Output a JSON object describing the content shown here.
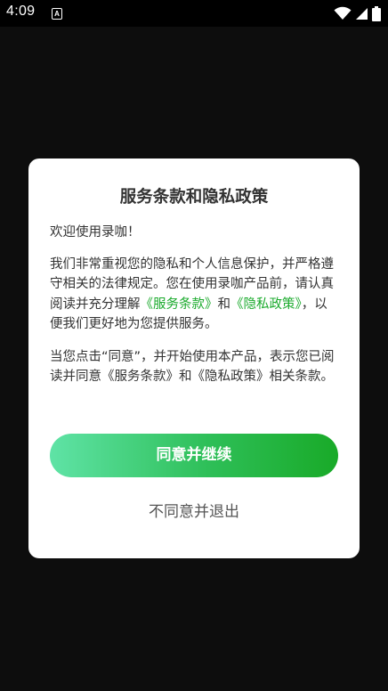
{
  "status_bar": {
    "time": "4:09",
    "app_icon_letter": "A",
    "icons": [
      "wifi-icon",
      "cell-signal-icon",
      "battery-icon"
    ]
  },
  "dialog": {
    "title": "服务条款和隐私政策",
    "welcome": "欢迎使用录咖！",
    "para1_prefix": "我们非常重视您的隐私和个人信息保护，并严格遵守相关的法律规定。您在使用录咖产品前，请认真阅读并充分理解",
    "link_terms": "《服务条款》",
    "para1_and": "和",
    "link_privacy": "《隐私政策》",
    "para1_suffix": "，以便我们更好地为您提供服务。",
    "para2": "当您点击“同意”，并开始使用本产品，表示您已阅读并同意《服务条款》和《隐私政策》相关条款。",
    "agree_label": "同意并继续",
    "disagree_label": "不同意并退出"
  },
  "colors": {
    "link": "#1aaa2c",
    "button_gradient_start": "#5fe3a6",
    "button_gradient_end": "#19aa28",
    "overlay_background": "#0d0d0d"
  }
}
